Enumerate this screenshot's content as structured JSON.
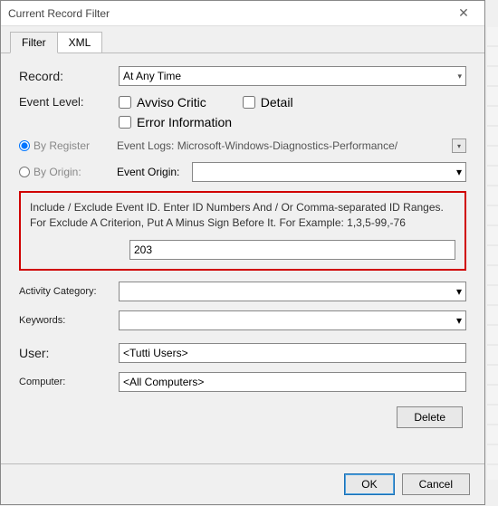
{
  "title": "Current Record Filter",
  "tabs": {
    "filter": "Filter",
    "xml": "XML"
  },
  "record": {
    "label": "Record:",
    "value": "At Any Time"
  },
  "eventLevel": {
    "label": "Event Level:",
    "options": {
      "critical": "Avviso Critic",
      "detail": "Detail",
      "error": "Error Information"
    }
  },
  "byRegister": {
    "label": "By Register",
    "logLabel": "Event Logs:",
    "logValue": "Microsoft-Windows-Diagnostics-Performance/"
  },
  "byOrigin": {
    "label": "By Origin:",
    "originLabel": "Event Origin:"
  },
  "idBox": {
    "desc": "Include / Exclude Event ID. Enter ID Numbers And / Or Comma-separated ID Ranges. For Exclude A Criterion, Put A Minus Sign Before It. For Example: 1,3,5-99,-76",
    "value": "203"
  },
  "activity": {
    "label": "Activity Category:"
  },
  "keywords": {
    "label": "Keywords:"
  },
  "user": {
    "label": "User:",
    "value": "<Tutti Users>"
  },
  "computer": {
    "label": "Computer:",
    "value": "<All Computers>"
  },
  "buttons": {
    "delete": "Delete",
    "ok": "OK",
    "cancel": "Cancel"
  }
}
